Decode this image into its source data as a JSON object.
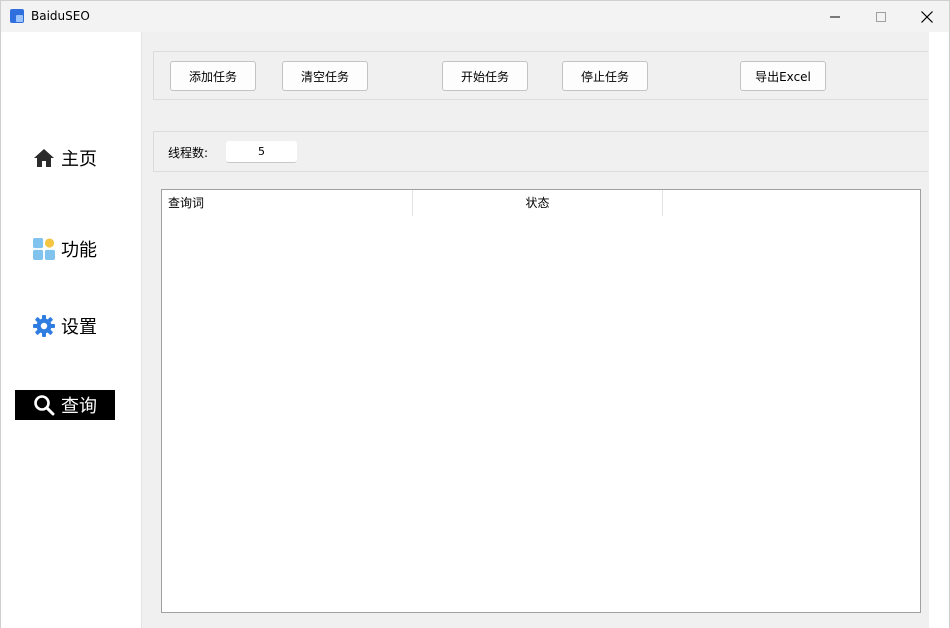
{
  "window": {
    "title": "BaiduSEO"
  },
  "sidebar": {
    "items": [
      {
        "label": "主页",
        "icon": "home-icon"
      },
      {
        "label": "功能",
        "icon": "apps-icon"
      },
      {
        "label": "设置",
        "icon": "gear-icon"
      },
      {
        "label": "查询",
        "icon": "search-icon",
        "active": true
      }
    ]
  },
  "toolbar": {
    "add_task": "添加任务",
    "clear_task": "清空任务",
    "start_task": "开始任务",
    "stop_task": "停止任务",
    "export_excel": "导出Excel"
  },
  "threads": {
    "label": "线程数:",
    "value": "5"
  },
  "table": {
    "columns": [
      "查询词",
      "状态"
    ],
    "rows": []
  },
  "colors": {
    "active_nav_bg": "#000000",
    "content_bg": "#f0f0f0",
    "icon_blue": "#2f7de1"
  }
}
